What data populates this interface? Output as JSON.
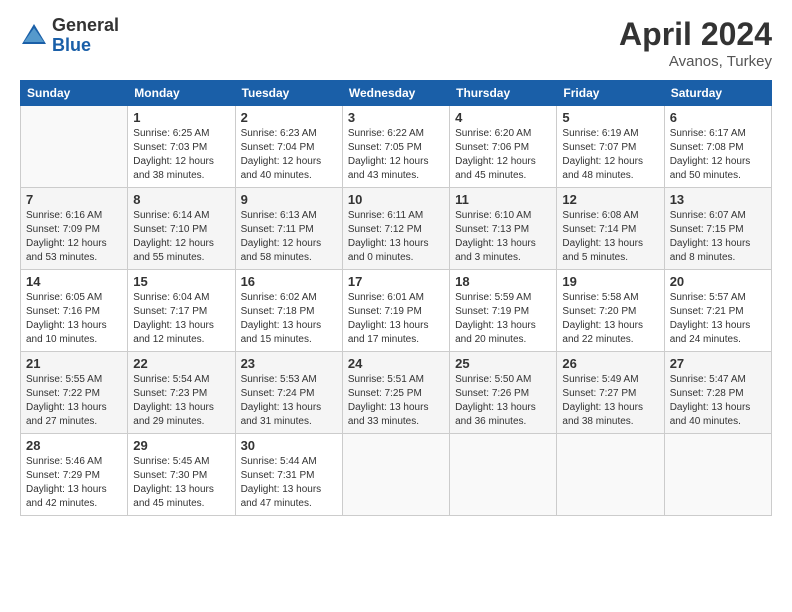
{
  "logo": {
    "general": "General",
    "blue": "Blue"
  },
  "title": "April 2024",
  "location": "Avanos, Turkey",
  "headers": [
    "Sunday",
    "Monday",
    "Tuesday",
    "Wednesday",
    "Thursday",
    "Friday",
    "Saturday"
  ],
  "weeks": [
    [
      {
        "day": "",
        "sunrise": "",
        "sunset": "",
        "daylight": ""
      },
      {
        "day": "1",
        "sunrise": "Sunrise: 6:25 AM",
        "sunset": "Sunset: 7:03 PM",
        "daylight": "Daylight: 12 hours and 38 minutes."
      },
      {
        "day": "2",
        "sunrise": "Sunrise: 6:23 AM",
        "sunset": "Sunset: 7:04 PM",
        "daylight": "Daylight: 12 hours and 40 minutes."
      },
      {
        "day": "3",
        "sunrise": "Sunrise: 6:22 AM",
        "sunset": "Sunset: 7:05 PM",
        "daylight": "Daylight: 12 hours and 43 minutes."
      },
      {
        "day": "4",
        "sunrise": "Sunrise: 6:20 AM",
        "sunset": "Sunset: 7:06 PM",
        "daylight": "Daylight: 12 hours and 45 minutes."
      },
      {
        "day": "5",
        "sunrise": "Sunrise: 6:19 AM",
        "sunset": "Sunset: 7:07 PM",
        "daylight": "Daylight: 12 hours and 48 minutes."
      },
      {
        "day": "6",
        "sunrise": "Sunrise: 6:17 AM",
        "sunset": "Sunset: 7:08 PM",
        "daylight": "Daylight: 12 hours and 50 minutes."
      }
    ],
    [
      {
        "day": "7",
        "sunrise": "Sunrise: 6:16 AM",
        "sunset": "Sunset: 7:09 PM",
        "daylight": "Daylight: 12 hours and 53 minutes."
      },
      {
        "day": "8",
        "sunrise": "Sunrise: 6:14 AM",
        "sunset": "Sunset: 7:10 PM",
        "daylight": "Daylight: 12 hours and 55 minutes."
      },
      {
        "day": "9",
        "sunrise": "Sunrise: 6:13 AM",
        "sunset": "Sunset: 7:11 PM",
        "daylight": "Daylight: 12 hours and 58 minutes."
      },
      {
        "day": "10",
        "sunrise": "Sunrise: 6:11 AM",
        "sunset": "Sunset: 7:12 PM",
        "daylight": "Daylight: 13 hours and 0 minutes."
      },
      {
        "day": "11",
        "sunrise": "Sunrise: 6:10 AM",
        "sunset": "Sunset: 7:13 PM",
        "daylight": "Daylight: 13 hours and 3 minutes."
      },
      {
        "day": "12",
        "sunrise": "Sunrise: 6:08 AM",
        "sunset": "Sunset: 7:14 PM",
        "daylight": "Daylight: 13 hours and 5 minutes."
      },
      {
        "day": "13",
        "sunrise": "Sunrise: 6:07 AM",
        "sunset": "Sunset: 7:15 PM",
        "daylight": "Daylight: 13 hours and 8 minutes."
      }
    ],
    [
      {
        "day": "14",
        "sunrise": "Sunrise: 6:05 AM",
        "sunset": "Sunset: 7:16 PM",
        "daylight": "Daylight: 13 hours and 10 minutes."
      },
      {
        "day": "15",
        "sunrise": "Sunrise: 6:04 AM",
        "sunset": "Sunset: 7:17 PM",
        "daylight": "Daylight: 13 hours and 12 minutes."
      },
      {
        "day": "16",
        "sunrise": "Sunrise: 6:02 AM",
        "sunset": "Sunset: 7:18 PM",
        "daylight": "Daylight: 13 hours and 15 minutes."
      },
      {
        "day": "17",
        "sunrise": "Sunrise: 6:01 AM",
        "sunset": "Sunset: 7:19 PM",
        "daylight": "Daylight: 13 hours and 17 minutes."
      },
      {
        "day": "18",
        "sunrise": "Sunrise: 5:59 AM",
        "sunset": "Sunset: 7:19 PM",
        "daylight": "Daylight: 13 hours and 20 minutes."
      },
      {
        "day": "19",
        "sunrise": "Sunrise: 5:58 AM",
        "sunset": "Sunset: 7:20 PM",
        "daylight": "Daylight: 13 hours and 22 minutes."
      },
      {
        "day": "20",
        "sunrise": "Sunrise: 5:57 AM",
        "sunset": "Sunset: 7:21 PM",
        "daylight": "Daylight: 13 hours and 24 minutes."
      }
    ],
    [
      {
        "day": "21",
        "sunrise": "Sunrise: 5:55 AM",
        "sunset": "Sunset: 7:22 PM",
        "daylight": "Daylight: 13 hours and 27 minutes."
      },
      {
        "day": "22",
        "sunrise": "Sunrise: 5:54 AM",
        "sunset": "Sunset: 7:23 PM",
        "daylight": "Daylight: 13 hours and 29 minutes."
      },
      {
        "day": "23",
        "sunrise": "Sunrise: 5:53 AM",
        "sunset": "Sunset: 7:24 PM",
        "daylight": "Daylight: 13 hours and 31 minutes."
      },
      {
        "day": "24",
        "sunrise": "Sunrise: 5:51 AM",
        "sunset": "Sunset: 7:25 PM",
        "daylight": "Daylight: 13 hours and 33 minutes."
      },
      {
        "day": "25",
        "sunrise": "Sunrise: 5:50 AM",
        "sunset": "Sunset: 7:26 PM",
        "daylight": "Daylight: 13 hours and 36 minutes."
      },
      {
        "day": "26",
        "sunrise": "Sunrise: 5:49 AM",
        "sunset": "Sunset: 7:27 PM",
        "daylight": "Daylight: 13 hours and 38 minutes."
      },
      {
        "day": "27",
        "sunrise": "Sunrise: 5:47 AM",
        "sunset": "Sunset: 7:28 PM",
        "daylight": "Daylight: 13 hours and 40 minutes."
      }
    ],
    [
      {
        "day": "28",
        "sunrise": "Sunrise: 5:46 AM",
        "sunset": "Sunset: 7:29 PM",
        "daylight": "Daylight: 13 hours and 42 minutes."
      },
      {
        "day": "29",
        "sunrise": "Sunrise: 5:45 AM",
        "sunset": "Sunset: 7:30 PM",
        "daylight": "Daylight: 13 hours and 45 minutes."
      },
      {
        "day": "30",
        "sunrise": "Sunrise: 5:44 AM",
        "sunset": "Sunset: 7:31 PM",
        "daylight": "Daylight: 13 hours and 47 minutes."
      },
      {
        "day": "",
        "sunrise": "",
        "sunset": "",
        "daylight": ""
      },
      {
        "day": "",
        "sunrise": "",
        "sunset": "",
        "daylight": ""
      },
      {
        "day": "",
        "sunrise": "",
        "sunset": "",
        "daylight": ""
      },
      {
        "day": "",
        "sunrise": "",
        "sunset": "",
        "daylight": ""
      }
    ]
  ]
}
